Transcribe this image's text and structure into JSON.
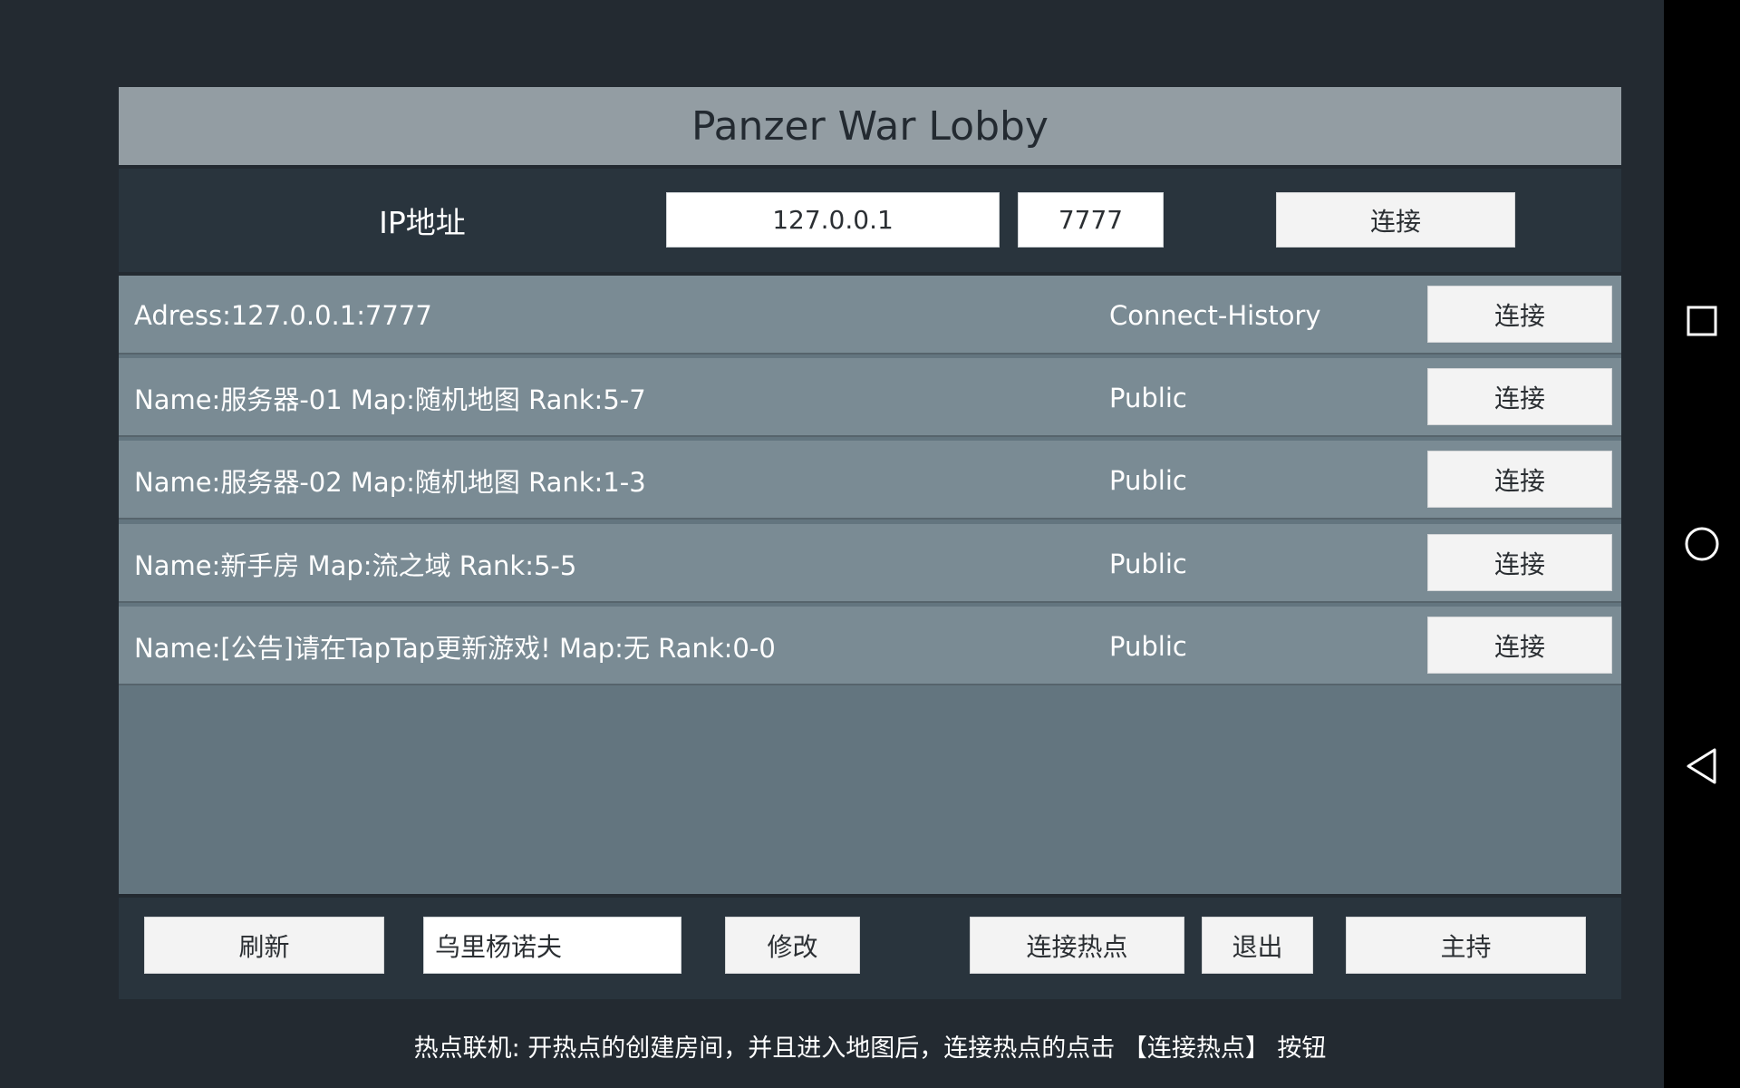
{
  "lobby": {
    "title": "Panzer War Lobby",
    "ip_label": "IP地址",
    "ip_value": "127.0.0.1",
    "port_value": "7777",
    "connect_label": "连接"
  },
  "servers": [
    {
      "text": "Adress:127.0.0.1:7777",
      "type": "Connect-History",
      "button": "连接"
    },
    {
      "text": "Name:服务器-01 Map:随机地图 Rank:5-7",
      "type": "Public",
      "button": "连接"
    },
    {
      "text": "Name:服务器-02 Map:随机地图 Rank:1-3",
      "type": "Public",
      "button": "连接"
    },
    {
      "text": "Name:新手房 Map:流之域 Rank:5-5",
      "type": "Public",
      "button": "连接"
    },
    {
      "text": "Name:[公告]请在TapTap更新游戏! Map:无 Rank:0-0",
      "type": "Public",
      "button": "连接"
    }
  ],
  "bottom": {
    "refresh_label": "刷新",
    "player_name": "乌里杨诺夫",
    "modify_label": "修改",
    "connect_hotspot_label": "连接热点",
    "exit_label": "退出",
    "host_label": "主持"
  },
  "hint": "热点联机: 开热点的创建房间，并且进入地图后，连接热点的点击 【连接热点】 按钮",
  "nav": {
    "icons": [
      "square-icon",
      "circle-icon",
      "back-triangle-icon"
    ]
  },
  "colors": {
    "background": "#232a31",
    "title_bar": "#939da3",
    "panel_dark": "#29343d",
    "row": "#7a8b94",
    "list_bg": "#63757f",
    "button": "#f3f3f3"
  }
}
